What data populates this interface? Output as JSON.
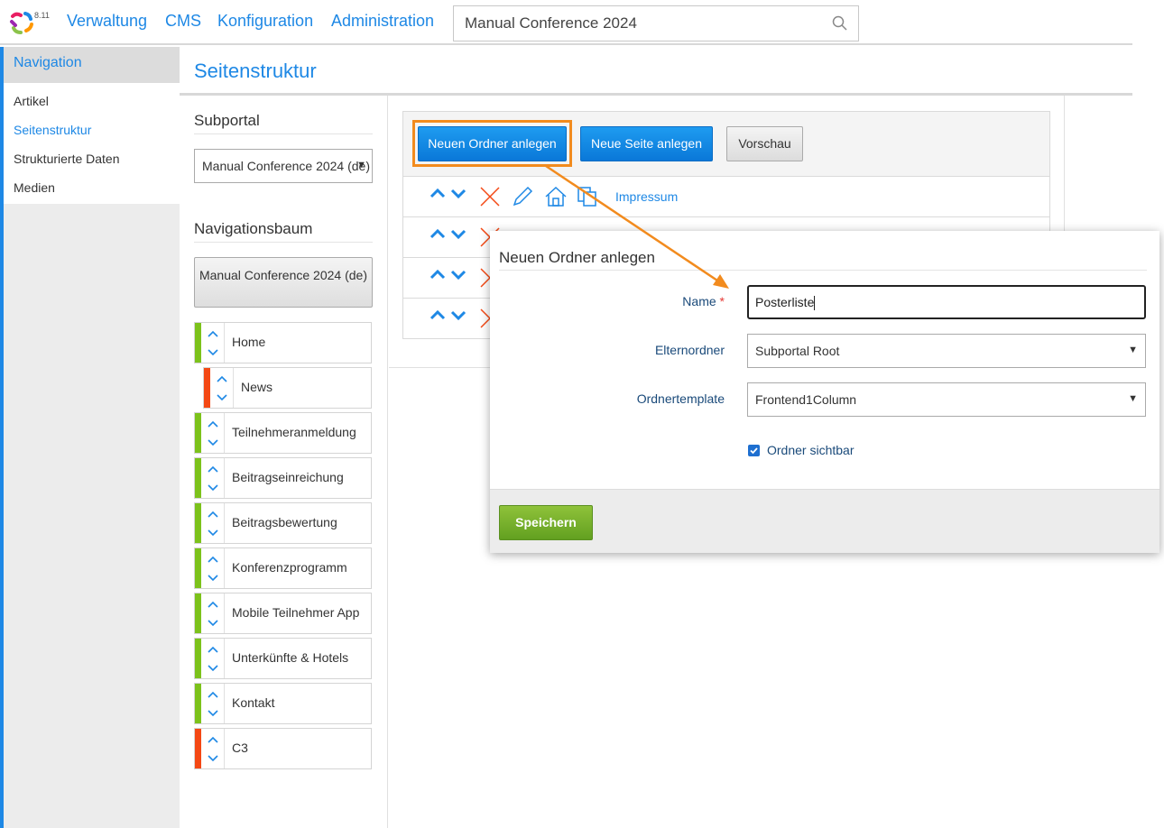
{
  "app": {
    "version": "8.11",
    "nav": [
      "Verwaltung",
      "CMS",
      "Konfiguration",
      "Administration"
    ],
    "search_value": "Manual Conference 2024"
  },
  "sidebar": {
    "header": "Navigation",
    "items": [
      "Artikel",
      "Seitenstruktur",
      "Strukturierte Daten",
      "Medien"
    ],
    "active_item": "Seitenstruktur"
  },
  "page": {
    "title": "Seitenstruktur",
    "subportal_label": "Subportal",
    "subportal_value": "Manual Conference 2024 (de)",
    "tree_label": "Navigationsbaum",
    "root_button": "Manual Conference 2024 (de)"
  },
  "tree": [
    {
      "label": "Home",
      "status": "green",
      "indent": 0
    },
    {
      "label": "News",
      "status": "red",
      "indent": 1
    },
    {
      "label": "Teilnehmeranmeldung",
      "status": "green",
      "indent": 0
    },
    {
      "label": "Beitragseinreichung",
      "status": "green",
      "indent": 0
    },
    {
      "label": "Beitragsbewertung",
      "status": "green",
      "indent": 0
    },
    {
      "label": "Konferenzprogramm",
      "status": "green",
      "indent": 0
    },
    {
      "label": "Mobile Teilnehmer App",
      "status": "green",
      "indent": 0
    },
    {
      "label": "Unterkünfte & Hotels",
      "status": "green",
      "indent": 0
    },
    {
      "label": "Kontakt",
      "status": "green",
      "indent": 0
    },
    {
      "label": "C3",
      "status": "red",
      "indent": 0
    }
  ],
  "toolbar": {
    "new_folder": "Neuen Ordner anlegen",
    "new_page": "Neue Seite anlegen",
    "preview": "Vorschau"
  },
  "page_rows": [
    {
      "link": "Impressum"
    }
  ],
  "dialog": {
    "title": "Neuen Ordner anlegen",
    "name_label": "Name",
    "name_required": "*",
    "name_value": "Posterliste",
    "parent_label": "Elternordner",
    "parent_value": "Subportal Root",
    "template_label": "Ordnertemplate",
    "template_value": "Frontend1Column",
    "visible_label": "Ordner sichtbar",
    "visible_checked": true,
    "save_label": "Speichern"
  },
  "colors": {
    "accent": "#1e88e5",
    "status_green": "#7cc21b",
    "status_red": "#f44814",
    "highlight": "#f28b1e",
    "save_green": "#6faa28"
  }
}
